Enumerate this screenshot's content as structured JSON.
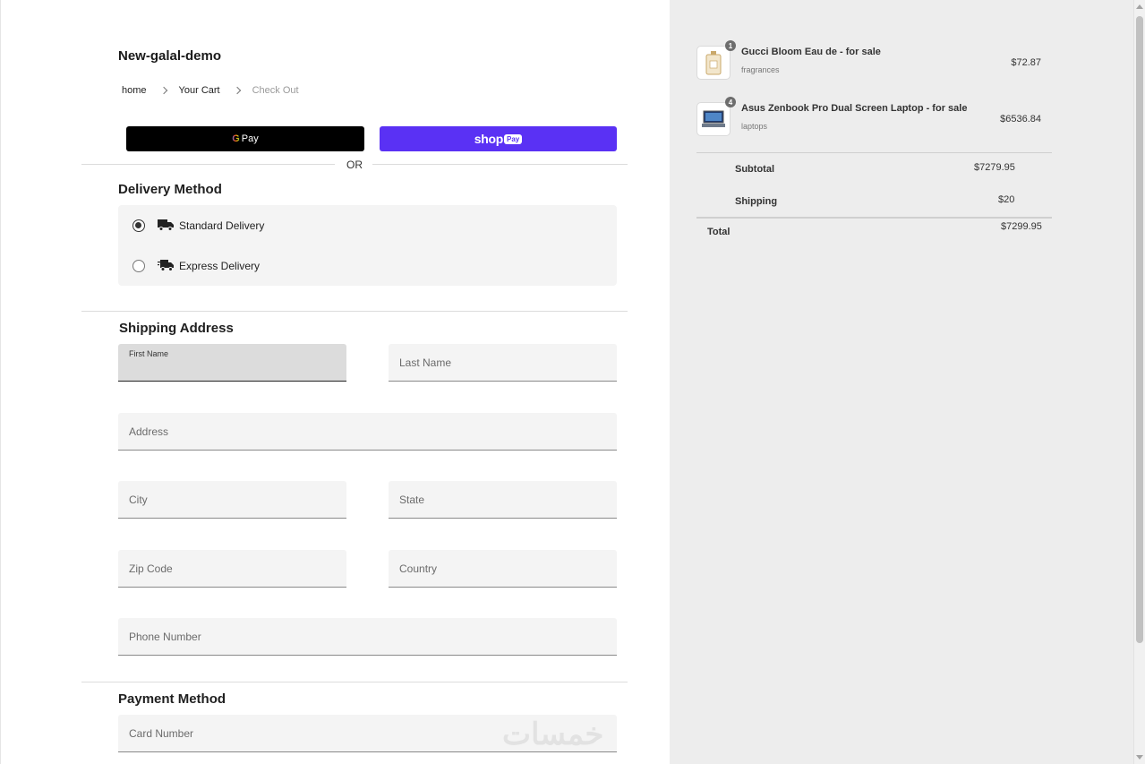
{
  "store": {
    "name": "New-galal-demo"
  },
  "breadcrumb": {
    "home": "home",
    "cart": "Your Cart",
    "checkout": "Check Out"
  },
  "express": {
    "gpay_g": "G",
    "gpay_label": "Pay",
    "shop_label": "shop",
    "shop_pay_badge": "Pay",
    "or": "OR"
  },
  "delivery": {
    "title": "Delivery Method",
    "options": [
      {
        "label": "Standard Delivery",
        "selected": true
      },
      {
        "label": "Express Delivery",
        "selected": false
      }
    ]
  },
  "shipping": {
    "title": "Shipping Address",
    "first_name": "First Name",
    "last_name": "Last Name",
    "address": "Address",
    "city": "City",
    "state": "State",
    "zip": "Zip Code",
    "country": "Country",
    "phone": "Phone Number"
  },
  "payment": {
    "title": "Payment Method",
    "card_number": "Card Number"
  },
  "watermark": "خمسات",
  "cart": {
    "items": [
      {
        "name": "Gucci Bloom Eau de - for sale",
        "category": "fragrances",
        "price": "$72.87",
        "qty": "1",
        "icon": "perfume-icon"
      },
      {
        "name": "Asus Zenbook Pro Dual Screen Laptop - for sale",
        "category": "laptops",
        "price": "$6536.84",
        "qty": "4",
        "icon": "laptop-icon"
      }
    ],
    "subtotal_label": "Subtotal",
    "subtotal": "$7279.95",
    "shipping_label": "Shipping",
    "shipping": "$20",
    "total_label": "Total",
    "total": "$7299.95"
  }
}
